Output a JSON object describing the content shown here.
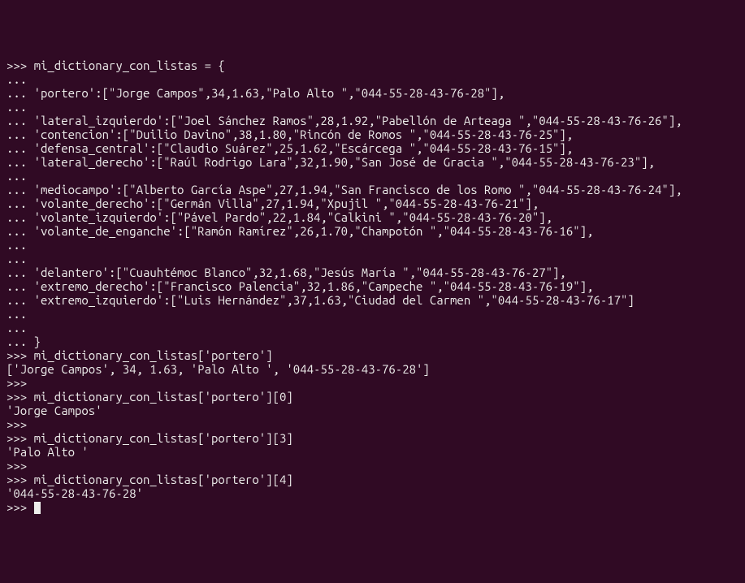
{
  "terminal": {
    "lines": [
      {
        "prompt": ">>> ",
        "text": "mi_dictionary_con_listas = {"
      },
      {
        "prompt": "... ",
        "text": ""
      },
      {
        "prompt": "... ",
        "text": "'portero':[\"Jorge Campos\",34,1.63,\"Palo Alto \",\"044-55-28-43-76-28\"],"
      },
      {
        "prompt": "... ",
        "text": ""
      },
      {
        "prompt": "... ",
        "text": "'lateral_izquierdo':[\"Joel Sánchez Ramos\",28,1.92,\"Pabellón de Arteaga \",\"044-55-28-43-76-26\"],"
      },
      {
        "prompt": "... ",
        "text": "'contencion':[\"Duilio Davino\",38,1.80,\"Rincón de Romos \",\"044-55-28-43-76-25\"],"
      },
      {
        "prompt": "... ",
        "text": "'defensa_central':[\"Claudio Suárez\",25,1.62,\"Escárcega \",\"044-55-28-43-76-15\"],"
      },
      {
        "prompt": "... ",
        "text": "'lateral_derecho':[\"Raúl Rodrigo Lara\",32,1.90,\"San José de Gracia \",\"044-55-28-43-76-23\"],"
      },
      {
        "prompt": "... ",
        "text": ""
      },
      {
        "prompt": "... ",
        "text": "'mediocampo':[\"Alberto García Aspe\",27,1.94,\"San Francisco de los Romo \",\"044-55-28-43-76-24\"],"
      },
      {
        "prompt": "... ",
        "text": "'volante_derecho':[\"Germán Villa\",27,1.94,\"Xpujil \",\"044-55-28-43-76-21\"],"
      },
      {
        "prompt": "... ",
        "text": "'volante_izquierdo':[\"Pável Pardo\",22,1.84,\"Calkini \",\"044-55-28-43-76-20\"],"
      },
      {
        "prompt": "... ",
        "text": "'volante_de_enganche':[\"Ramón Ramírez\",26,1.70,\"Champotón \",\"044-55-28-43-76-16\"],"
      },
      {
        "prompt": "... ",
        "text": ""
      },
      {
        "prompt": "... ",
        "text": ""
      },
      {
        "prompt": "... ",
        "text": "'delantero':[\"Cuauhtémoc Blanco\",32,1.68,\"Jesús María \",\"044-55-28-43-76-27\"],"
      },
      {
        "prompt": "... ",
        "text": "'extremo_derecho':[\"Francisco Palencia\",32,1.86,\"Campeche \",\"044-55-28-43-76-19\"],"
      },
      {
        "prompt": "... ",
        "text": "'extremo_izquierdo':[\"Luis Hernández\",37,1.63,\"Ciudad del Carmen \",\"044-55-28-43-76-17\"]"
      },
      {
        "prompt": "... ",
        "text": ""
      },
      {
        "prompt": "... ",
        "text": ""
      },
      {
        "prompt": "... ",
        "text": "}"
      },
      {
        "prompt": ">>> ",
        "text": "mi_dictionary_con_listas['portero']"
      },
      {
        "prompt": "",
        "text": "['Jorge Campos', 34, 1.63, 'Palo Alto ', '044-55-28-43-76-28']"
      },
      {
        "prompt": ">>> ",
        "text": ""
      },
      {
        "prompt": ">>> ",
        "text": "mi_dictionary_con_listas['portero'][0]"
      },
      {
        "prompt": "",
        "text": "'Jorge Campos'"
      },
      {
        "prompt": ">>> ",
        "text": ""
      },
      {
        "prompt": ">>> ",
        "text": "mi_dictionary_con_listas['portero'][3]"
      },
      {
        "prompt": "",
        "text": "'Palo Alto '"
      },
      {
        "prompt": ">>> ",
        "text": ""
      },
      {
        "prompt": ">>> ",
        "text": "mi_dictionary_con_listas['portero'][4]"
      },
      {
        "prompt": "",
        "text": "'044-55-28-43-76-28'"
      },
      {
        "prompt": ">>> ",
        "text": ""
      }
    ]
  }
}
